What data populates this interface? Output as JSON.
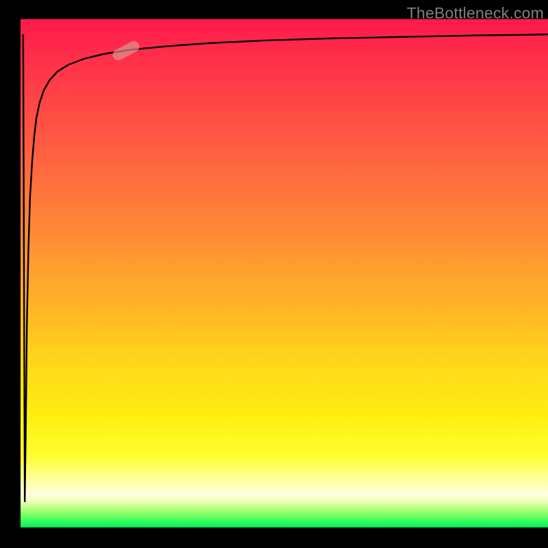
{
  "watermark": "TheBottleneck.com",
  "colors": {
    "page_bg": "#000000",
    "watermark": "#808080",
    "curve": "#000000",
    "marker": "rgba(220,160,150,0.62)"
  },
  "chart_data": {
    "type": "line",
    "title": "",
    "xlabel": "",
    "ylabel": "",
    "xlim": [
      0,
      100
    ],
    "ylim": [
      0,
      100
    ],
    "grid": false,
    "legend": false,
    "annotations": [
      "TheBottleneck.com"
    ],
    "gradient_stops": [
      {
        "pos": 0.0,
        "color": "#ff1a4a"
      },
      {
        "pos": 0.18,
        "color": "#ff4a45"
      },
      {
        "pos": 0.42,
        "color": "#ff8a35"
      },
      {
        "pos": 0.68,
        "color": "#ffd81a"
      },
      {
        "pos": 0.86,
        "color": "#ffff30"
      },
      {
        "pos": 0.95,
        "color": "#e8ffb0"
      },
      {
        "pos": 1.0,
        "color": "#00e860"
      }
    ],
    "series": [
      {
        "name": "bottleneck-curve",
        "x": [
          0.5,
          0.8,
          1.0,
          1.2,
          1.5,
          1.8,
          2.2,
          2.6,
          3.0,
          3.6,
          4.4,
          5.5,
          7.0,
          9.0,
          12.0,
          16.0,
          21.0,
          28.0,
          36.0,
          46.0,
          58.0,
          72.0,
          86.0,
          100.0
        ],
        "y": [
          97.0,
          5.0,
          20.0,
          40.0,
          55.0,
          65.0,
          72.0,
          77.0,
          80.5,
          83.5,
          86.0,
          88.0,
          89.7,
          91.0,
          92.2,
          93.2,
          94.0,
          94.7,
          95.3,
          95.8,
          96.2,
          96.5,
          96.8,
          97.0
        ]
      }
    ],
    "marker": {
      "x": 20.0,
      "y": 93.8,
      "angle_deg": -28
    }
  }
}
